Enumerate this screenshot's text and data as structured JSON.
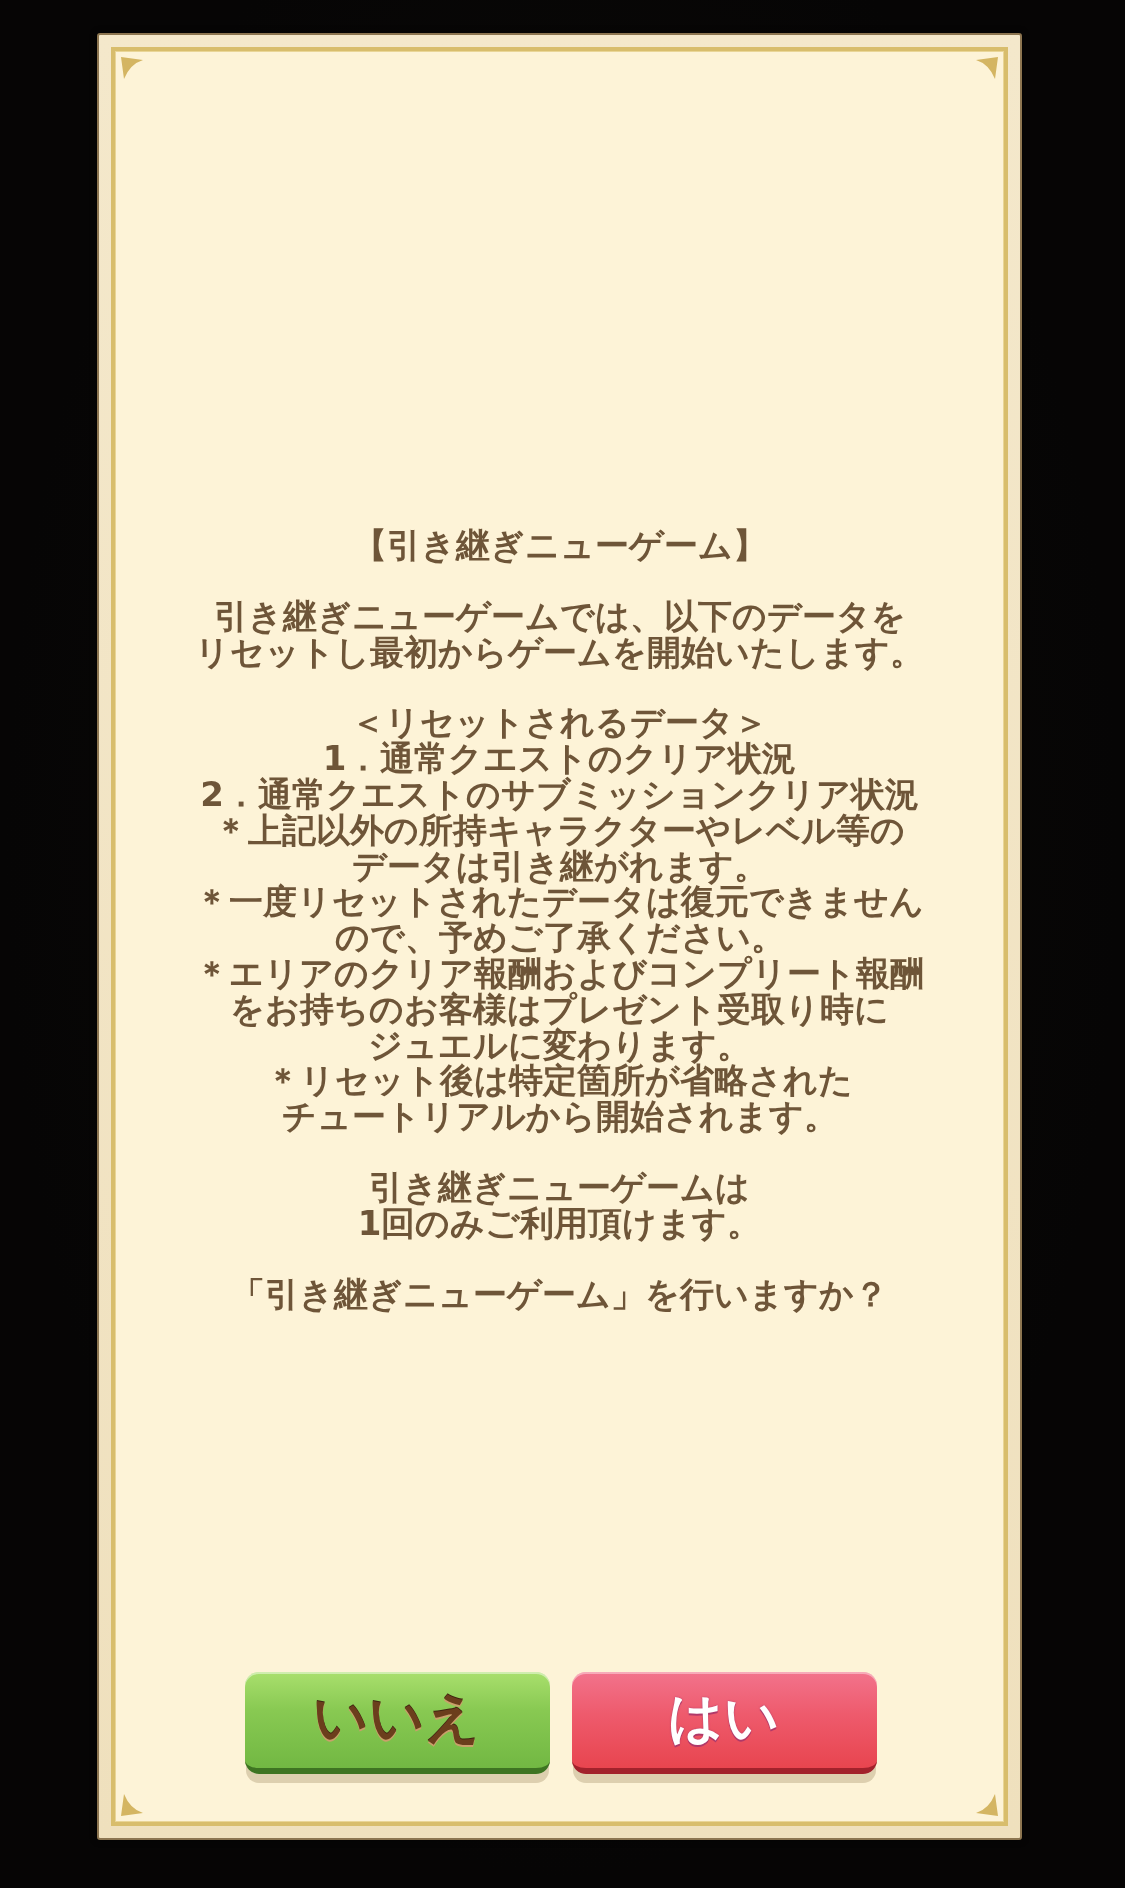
{
  "dialog": {
    "title": "【引き継ぎニューゲーム】",
    "intro": [
      "引き継ぎニューゲームでは、以下のデータを",
      "リセットし最初からゲームを開始いたします。"
    ],
    "reset_section": {
      "heading": "＜リセットされるデータ＞",
      "items": [
        "1．通常クエストのクリア状況",
        "2．通常クエストのサブミッションクリア状況"
      ]
    },
    "notes": [
      [
        "＊上記以外の所持キャラクターやレベル等の",
        "データは引き継がれます。"
      ],
      [
        "＊一度リセットされたデータは復元できません",
        "ので、予めご了承ください。"
      ],
      [
        "＊エリアのクリア報酬およびコンプリート報酬",
        "をお持ちのお客様はプレゼント受取り時に",
        "ジュエルに変わります。"
      ],
      [
        "＊リセット後は特定箇所が省略された",
        "チュートリアルから開始されます。"
      ]
    ],
    "closing": [
      "引き継ぎニューゲームは",
      "1回のみご利用頂けます。"
    ],
    "question": "「引き継ぎニューゲーム」を行いますか？",
    "buttons": [
      {
        "label": "いいえ",
        "kind": "cancel"
      },
      {
        "label": "はい",
        "kind": "confirm"
      }
    ]
  }
}
